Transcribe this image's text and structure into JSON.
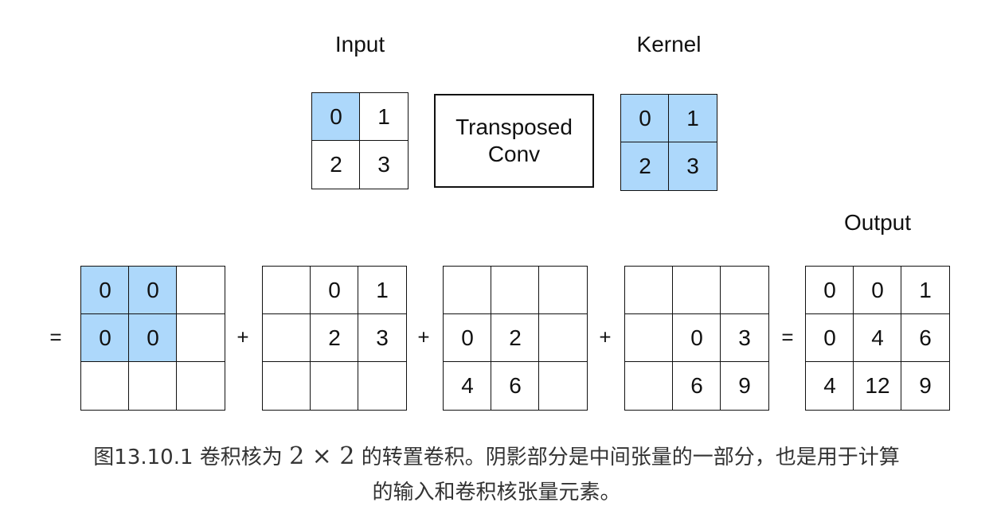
{
  "labels": {
    "input": "Input",
    "kernel": "Kernel",
    "output": "Output"
  },
  "operation": {
    "line1": "Transposed",
    "line2": "Conv"
  },
  "input_matrix": [
    [
      "0",
      "1"
    ],
    [
      "2",
      "3"
    ]
  ],
  "kernel_matrix": [
    [
      "0",
      "1"
    ],
    [
      "2",
      "3"
    ]
  ],
  "partials": [
    [
      [
        "0",
        "0",
        ""
      ],
      [
        "0",
        "0",
        ""
      ],
      [
        "",
        "",
        ""
      ]
    ],
    [
      [
        "",
        "0",
        "1"
      ],
      [
        "",
        "2",
        "3"
      ],
      [
        "",
        "",
        ""
      ]
    ],
    [
      [
        "",
        "",
        ""
      ],
      [
        "0",
        "2",
        ""
      ],
      [
        "4",
        "6",
        ""
      ]
    ],
    [
      [
        "",
        "",
        ""
      ],
      [
        "",
        "0",
        "3"
      ],
      [
        "",
        "6",
        "9"
      ]
    ]
  ],
  "output_matrix": [
    [
      "0",
      "0",
      "1"
    ],
    [
      "0",
      "4",
      "6"
    ],
    [
      "4",
      "12",
      "9"
    ]
  ],
  "operators": {
    "equals": "=",
    "plus": "+"
  },
  "caption": {
    "line1_prefix": "图13.10.1  卷积核为 ",
    "math": "2 × 2",
    "line1_suffix": " 的转置卷积。阴影部分是中间张量的一部分，也是用于计算",
    "line2": "的输入和卷积核张量元素。"
  },
  "colors": {
    "highlight": "#add8fb",
    "border": "#111111"
  }
}
